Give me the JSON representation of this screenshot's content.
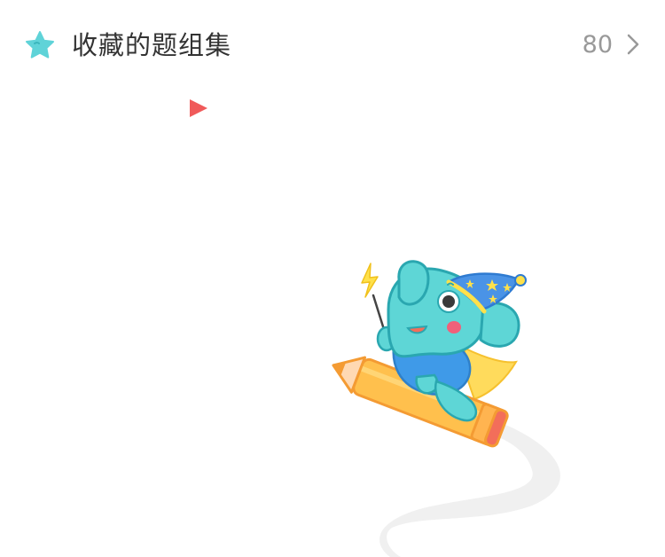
{
  "header": {
    "title": "收藏的题组集",
    "count": "80",
    "icon": "star-icon",
    "chevron": "chevron-right-icon"
  },
  "colors": {
    "accent_star": "#5fd3d8",
    "title_text": "#333333",
    "count_text": "#999999",
    "flag_red": "#f05a5a",
    "elephant": "#5ed6d6",
    "pencil": "#f7a843",
    "hat": "#4a93e6"
  },
  "illustration": {
    "icon": "elephant-wizard-on-pencil-illustration"
  }
}
